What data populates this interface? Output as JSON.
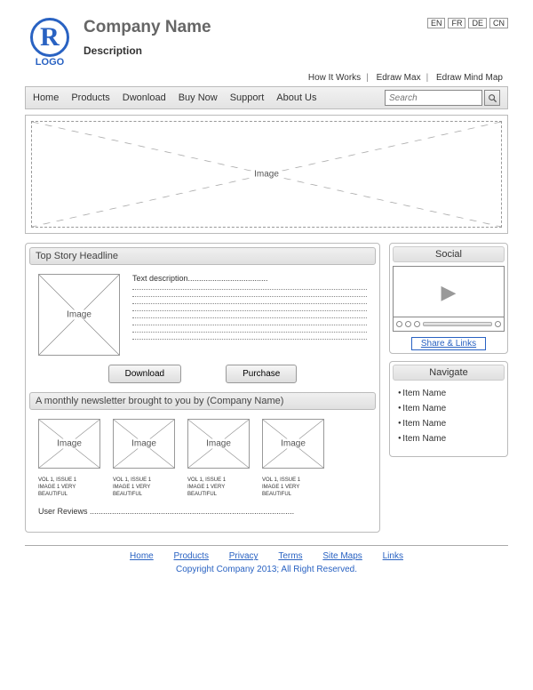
{
  "header": {
    "logo_letter": "R",
    "logo_text": "LOGO",
    "title": "Company Name",
    "description": "Description",
    "langs": [
      "EN",
      "FR",
      "DE",
      "CN"
    ],
    "toplinks": [
      "How It Works",
      "Edraw Max",
      "Edraw Mind Map"
    ]
  },
  "nav": {
    "items": [
      "Home",
      "Products",
      "Dwonload",
      "Buy Now",
      "Support",
      "About Us"
    ],
    "search_placeholder": "Search"
  },
  "hero": {
    "label": "Image"
  },
  "top_story": {
    "headline": "Top Story Headline",
    "image_label": "Image",
    "text_intro": "Text description",
    "download": "Download",
    "purchase": "Purchase"
  },
  "newsletter": {
    "title": "A monthly newsletter brought to you by (Company Name)",
    "thumbs": [
      {
        "label": "Image",
        "caption": "VOL 1, ISSUE 1\nIMAGE 1 VERY\nBEAUTIFUL"
      },
      {
        "label": "Image",
        "caption": "VOL 1, ISSUE 1\nIMAGE 1 VERY\nBEAUTIFUL"
      },
      {
        "label": "Image",
        "caption": "VOL 1, ISSUE 1\nIMAGE 1 VERY\nBEAUTIFUL"
      },
      {
        "label": "Image",
        "caption": "VOL 1, ISSUE 1\nIMAGE 1 VERY\nBEAUTIFUL"
      }
    ],
    "reviews_label": "User Reviews"
  },
  "social": {
    "title": "Social",
    "share": "Share & Links"
  },
  "navigate": {
    "title": "Navigate",
    "items": [
      "Item Name",
      "Item Name",
      "Item Name",
      "Item Name"
    ]
  },
  "footer": {
    "links": [
      "Home",
      "Products",
      "Privacy",
      "Terms",
      "Site Maps",
      "Links"
    ],
    "copyright": "Copyright Company 2013; All Right Reserved."
  }
}
